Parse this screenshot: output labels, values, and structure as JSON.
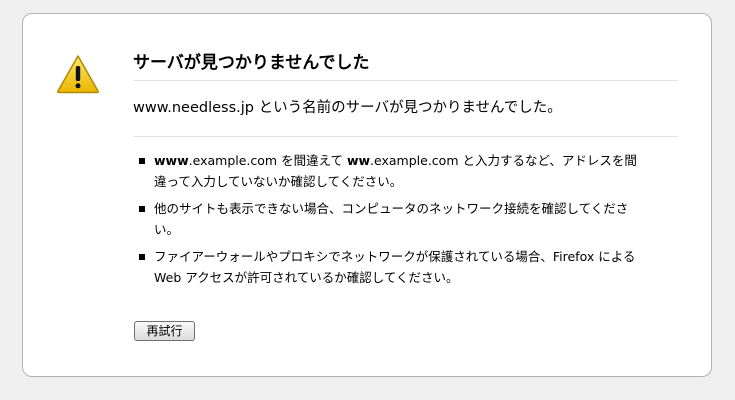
{
  "error_page": {
    "title": "サーバが見つかりませんでした",
    "message": "www.needless.jp という名前のサーバが見つかりませんでした。",
    "suggestions": [
      {
        "parts": [
          "www",
          ".example.com を間違えて ",
          "ww",
          ".example.com と入力するなど、アドレスを間違って入力していないか確認してください。"
        ]
      },
      {
        "text": "他のサイトも表示できない場合、コンピュータのネットワーク接続を確認してください。"
      },
      {
        "text": "ファイアーウォールやプロキシでネットワークが保護されている場合、Firefox によるWeb アクセスが許可されているか確認してください。"
      }
    ],
    "retry_label": "再試行"
  },
  "icons": {
    "warning": "warning-triangle-icon"
  },
  "colors": {
    "background": "#efefef",
    "card": "#ffffff",
    "card_border": "#b3b3b3",
    "warning_fill": "#f7d01b",
    "warning_border": "#b08a00"
  }
}
